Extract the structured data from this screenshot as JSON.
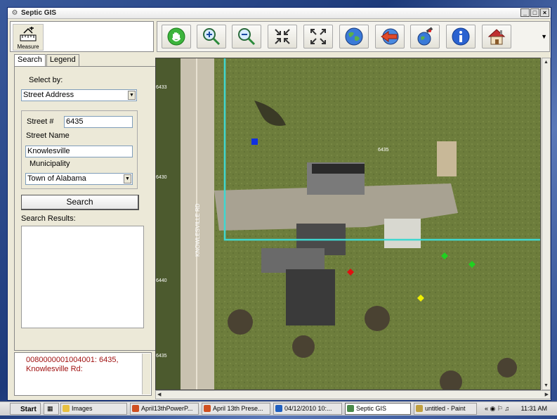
{
  "window": {
    "title": "Septic GIS"
  },
  "measure": {
    "label": "Measure"
  },
  "toolbar": {
    "tools": [
      "pan-icon",
      "zoom-in-icon",
      "zoom-out-icon",
      "zoom-extent-in-icon",
      "full-extent-icon",
      "globe-icon",
      "back-extent-icon",
      "satellite-icon",
      "info-icon",
      "house-icon"
    ]
  },
  "tabs": [
    {
      "label": "Search"
    },
    {
      "label": "Legend"
    }
  ],
  "search": {
    "select_by_label": "Select by:",
    "select_by_value": "Street Address",
    "street_no_label": "Street #",
    "street_no_value": "6435",
    "street_name_label": "Street Name",
    "street_name_value": "Knowlesville",
    "municipality_label": "Municipality",
    "municipality_value": "Town of Alabama",
    "button_label": "Search",
    "results_label": "Search Results:"
  },
  "result": {
    "text": "0080000001004001: 6435, Knowlesville Rd:"
  },
  "map": {
    "road_label": "KNOWLESVILLE RD",
    "parcel_labels": [
      "6433",
      "6435",
      "6430",
      "6440",
      "6435"
    ],
    "colors": {
      "parcel_line": "#3fd7d0",
      "blue_marker": "#1030e0",
      "red_marker": "#e01010",
      "green_marker": "#20d020",
      "yellow_marker": "#f0f000"
    }
  },
  "taskbar": {
    "start_label": "Start",
    "tasks": [
      {
        "label": "Images"
      },
      {
        "label": "April13thPowerP..."
      },
      {
        "label": "April 13th Prese..."
      },
      {
        "label": "04/12/2010 10:..."
      },
      {
        "label": "Septic GIS"
      },
      {
        "label": "untitled - Paint"
      }
    ],
    "clock": "11:31 AM"
  }
}
